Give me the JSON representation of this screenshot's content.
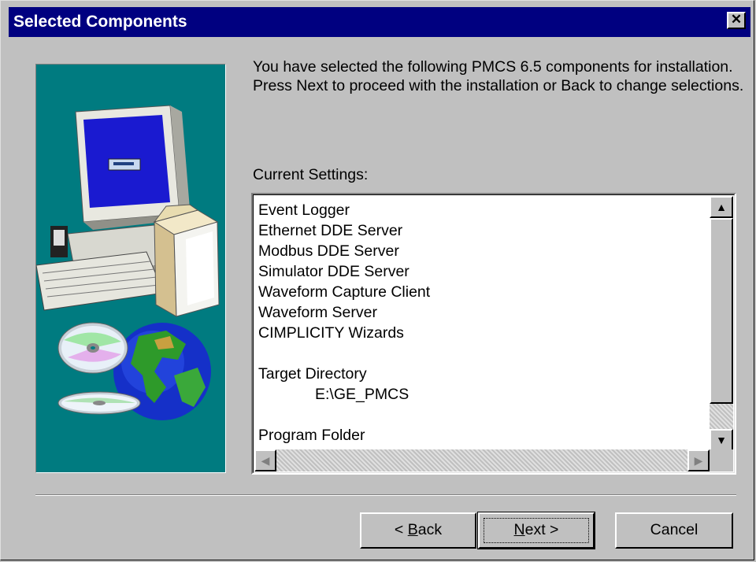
{
  "window": {
    "title": "Selected Components",
    "close_glyph": "✕"
  },
  "intro_text": "You have selected the following PMCS 6.5 components for installation. Press Next to proceed with the installation or Back to change selections.",
  "settings": {
    "label": "Current Settings:",
    "components": [
      "Event Logger",
      "Ethernet DDE Server",
      "Modbus DDE Server",
      "Simulator DDE Server",
      "Waveform Capture Client",
      "Waveform Server",
      "CIMPLICITY Wizards"
    ],
    "target_directory_label": "Target Directory",
    "target_directory_value": "E:\\GE_PMCS",
    "program_folder_label": "Program Folder"
  },
  "buttons": {
    "back": {
      "prefix": "< ",
      "accel": "B",
      "rest": "ack"
    },
    "next": {
      "accel": "N",
      "rest": "ext >"
    },
    "cancel": "Cancel"
  },
  "colors": {
    "titlebar": "#000080",
    "image_background": "#007b80",
    "dialog": "#c0c0c0"
  },
  "illustration_icons": [
    "computer-icon",
    "software-box-icon",
    "cd-icon",
    "globe-icon"
  ]
}
